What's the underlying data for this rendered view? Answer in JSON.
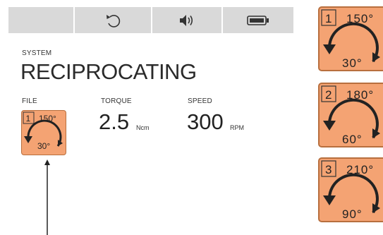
{
  "toolbar": {
    "cells": [
      {
        "icon": "blank"
      },
      {
        "icon": "rotate-ccw-icon"
      },
      {
        "icon": "speaker-icon"
      },
      {
        "icon": "battery-icon"
      }
    ]
  },
  "system": {
    "label": "SYSTEM",
    "mode": "RECIPROCATING"
  },
  "file": {
    "label": "FILE",
    "number": "1",
    "angle_forward": "150°",
    "angle_reverse": "30°"
  },
  "torque": {
    "label": "TORQUE",
    "value": "2.5",
    "unit": "Ncm"
  },
  "speed": {
    "label": "SPEED",
    "value": "300",
    "unit": "RPM"
  },
  "side_cards": [
    {
      "number": "1",
      "angle_forward": "150°",
      "angle_reverse": "30°"
    },
    {
      "number": "2",
      "angle_forward": "180°",
      "angle_reverse": "60°"
    },
    {
      "number": "3",
      "angle_forward": "210°",
      "angle_reverse": "90°"
    }
  ],
  "colors": {
    "card_fill": "#f4a373",
    "card_border": "#b86f3e",
    "toolbar_bg": "#d9d9d9"
  }
}
